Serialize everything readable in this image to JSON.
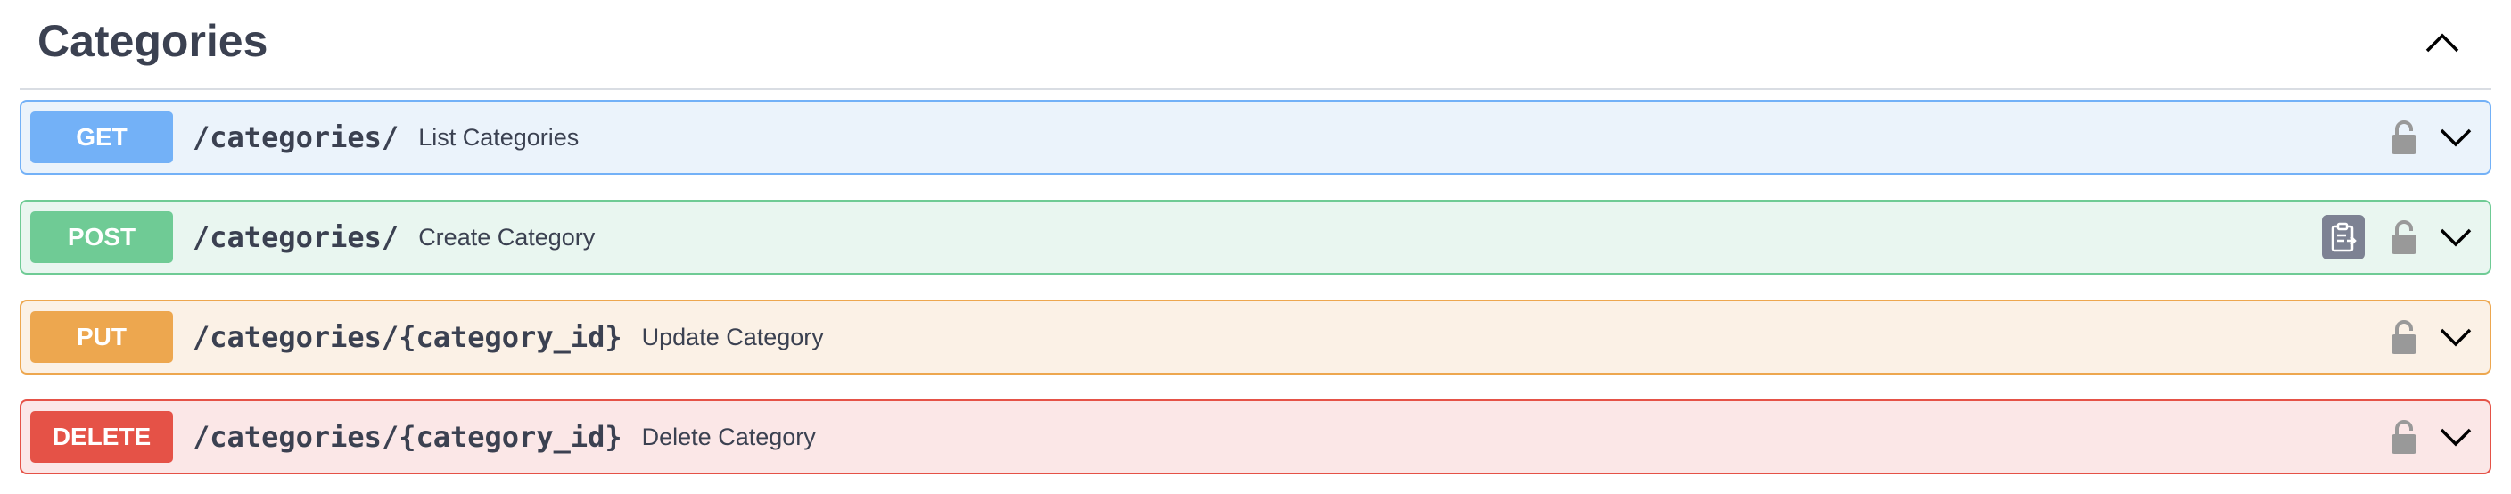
{
  "section": {
    "title": "Categories"
  },
  "operations": [
    {
      "method": "GET",
      "path": "/categories/",
      "summary": "List Categories",
      "color": "#61affe",
      "method_bg": "#73b1f7",
      "bg": "#ebf3fb",
      "border": "#73b1f7",
      "has_copy": false
    },
    {
      "method": "POST",
      "path": "/categories/",
      "summary": "Create Category",
      "color": "#49cc90",
      "method_bg": "#6fcb95",
      "bg": "#e9f6f0",
      "border": "#6fcb95",
      "has_copy": true
    },
    {
      "method": "PUT",
      "path": "/categories/{category_id}",
      "summary": "Update Category",
      "color": "#fca130",
      "method_bg": "#eda74f",
      "bg": "#fbf1e6",
      "border": "#eda74f",
      "has_copy": false
    },
    {
      "method": "DELETE",
      "path": "/categories/{category_id}",
      "summary": "Delete Category",
      "color": "#f93e3e",
      "method_bg": "#e55247",
      "bg": "#fbe7e7",
      "border": "#e55247",
      "has_copy": false
    }
  ],
  "icons": {
    "collapse": "chevron-up-icon",
    "lock": "lock-icon",
    "expand": "chevron-down-icon",
    "copy": "clipboard-icon"
  }
}
